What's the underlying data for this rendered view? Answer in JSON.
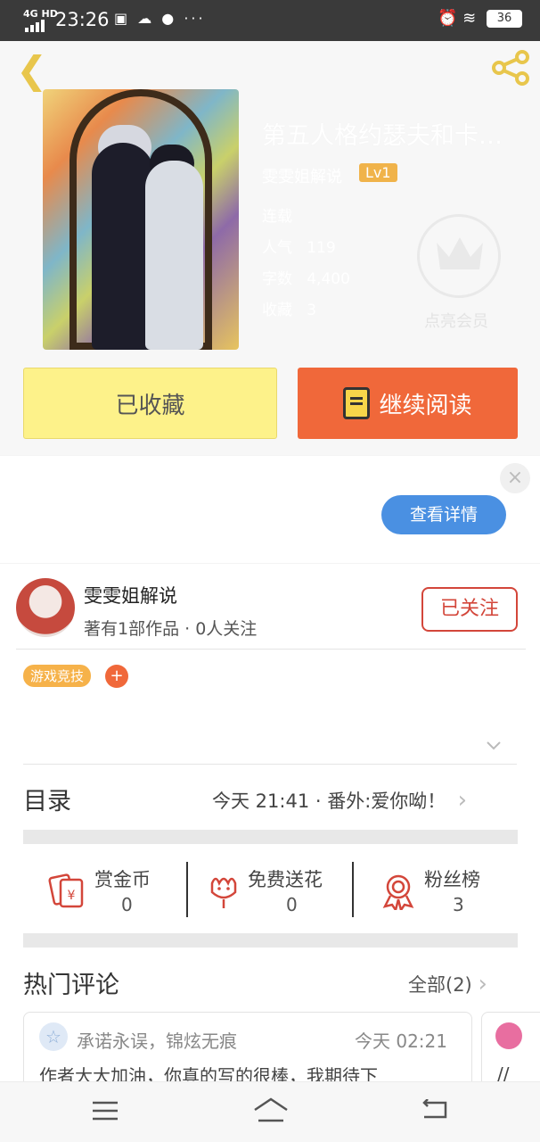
{
  "status_bar": {
    "network": "4G HD",
    "time": "23:26",
    "apps": "▣ ☁ ● ···",
    "battery": "36"
  },
  "book": {
    "title": "第五人格约瑟夫和卡…",
    "author": "雯雯姐解说",
    "level": "Lv1",
    "status": "连载",
    "popularity_label": "人气",
    "popularity": "119",
    "words_label": "字数",
    "words": "4,400",
    "favorites_label": "收藏",
    "favorites": "3"
  },
  "vip": {
    "label": "点亮会员"
  },
  "actions": {
    "favorited_label": "已收藏",
    "continue_label": "继续阅读"
  },
  "ad": {
    "close_label": "×",
    "details_label": "查看详情"
  },
  "author_card": {
    "name": "雯雯姐解说",
    "stats": "著有1部作品 · 0人关注",
    "follow_label": "已关注",
    "tag": "游戏竞技",
    "tag_add": "+"
  },
  "toc": {
    "label": "目录",
    "latest": "今天 21:41 · 番外:爱你呦！",
    "chevron": "›"
  },
  "stats": [
    {
      "label": "赏金币",
      "value": "0"
    },
    {
      "label": "免费送花",
      "value": "0"
    },
    {
      "label": "粉丝榜",
      "value": "3"
    }
  ],
  "hot_comments": {
    "label": "热门评论",
    "all_label": "全部(2)",
    "chevron": "›",
    "items": [
      {
        "user": "承诺永误，锦炫无痕",
        "time": "今天 02:21",
        "text": "作者大大加油，你真的写的很棒，我期待下"
      },
      {
        "text": "//"
      }
    ]
  },
  "colors": {
    "accent_orange": "#f0683a",
    "fav_yellow": "#fdf28a",
    "follow_red": "#d3463a",
    "button_blue": "#4a90e2"
  }
}
